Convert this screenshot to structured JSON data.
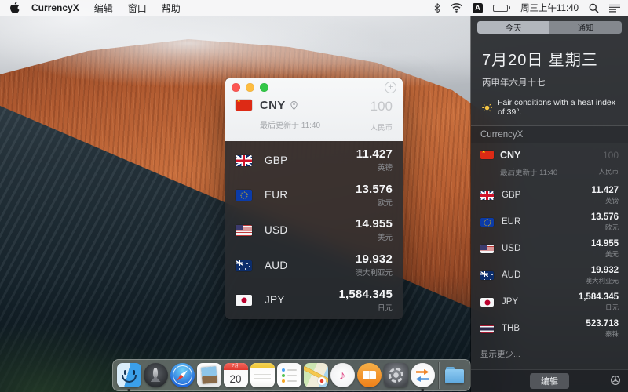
{
  "menu_bar": {
    "app_name": "CurrencyX",
    "menus": [
      "编辑",
      "窗口",
      "帮助"
    ],
    "input_source": "A",
    "clock": "周三上午11:40"
  },
  "window": {
    "base": {
      "flag": "cn",
      "code": "CNY",
      "updated": "最后更新于 11:40",
      "amount": "100",
      "name": "人民币"
    },
    "rates": [
      {
        "flag": "gb",
        "code": "GBP",
        "value": "11.427",
        "name": "英镑"
      },
      {
        "flag": "eu",
        "code": "EUR",
        "value": "13.576",
        "name": "欧元"
      },
      {
        "flag": "us",
        "code": "USD",
        "value": "14.955",
        "name": "美元"
      },
      {
        "flag": "au",
        "code": "AUD",
        "value": "19.932",
        "name": "澳大利亚元"
      },
      {
        "flag": "jp",
        "code": "JPY",
        "value": "1,584.345",
        "name": "日元"
      }
    ]
  },
  "notification_center": {
    "tab_today": "今天",
    "tab_notifications": "通知",
    "date_title": "7月20日 星期三",
    "lunar_date": "丙申年六月十七",
    "weather_text": "Fair conditions with a heat index of 39°.",
    "widget_title": "CurrencyX",
    "base": {
      "flag": "cn",
      "code": "CNY",
      "updated": "最后更新于 11:40",
      "amount": "100",
      "name": "人民币"
    },
    "rates": [
      {
        "flag": "gb",
        "code": "GBP",
        "value": "11.427",
        "name": "英镑"
      },
      {
        "flag": "eu",
        "code": "EUR",
        "value": "13.576",
        "name": "欧元"
      },
      {
        "flag": "us",
        "code": "USD",
        "value": "14.955",
        "name": "美元"
      },
      {
        "flag": "au",
        "code": "AUD",
        "value": "19.932",
        "name": "澳大利亚元"
      },
      {
        "flag": "jp",
        "code": "JPY",
        "value": "1,584.345",
        "name": "日元"
      },
      {
        "flag": "th",
        "code": "THB",
        "value": "523.718",
        "name": "泰铢"
      }
    ],
    "show_less": "显示更少...",
    "edit_button": "编辑"
  },
  "dock": {
    "items": [
      {
        "icon": "finder",
        "running": true
      },
      {
        "icon": "launchpad"
      },
      {
        "icon": "safari"
      },
      {
        "icon": "preview"
      },
      {
        "icon": "calendar",
        "month": "7月",
        "day": "20"
      },
      {
        "icon": "notes"
      },
      {
        "icon": "reminders"
      },
      {
        "icon": "maps"
      },
      {
        "icon": "itunes"
      },
      {
        "icon": "ibooks"
      },
      {
        "icon": "sysprefs"
      },
      {
        "icon": "currencyx",
        "running": true
      },
      {
        "icon": "divider"
      },
      {
        "icon": "folder"
      }
    ]
  },
  "colors": {
    "cliff_orange": "#c96f3d",
    "panel_bg": "#27292d",
    "window_dark": "#292b2f",
    "traffic_red": "#fc5753",
    "traffic_yellow": "#fdbc40",
    "traffic_green": "#33c748",
    "accent_arrow_orange": "#f08427",
    "accent_arrow_blue": "#4a90d9"
  }
}
